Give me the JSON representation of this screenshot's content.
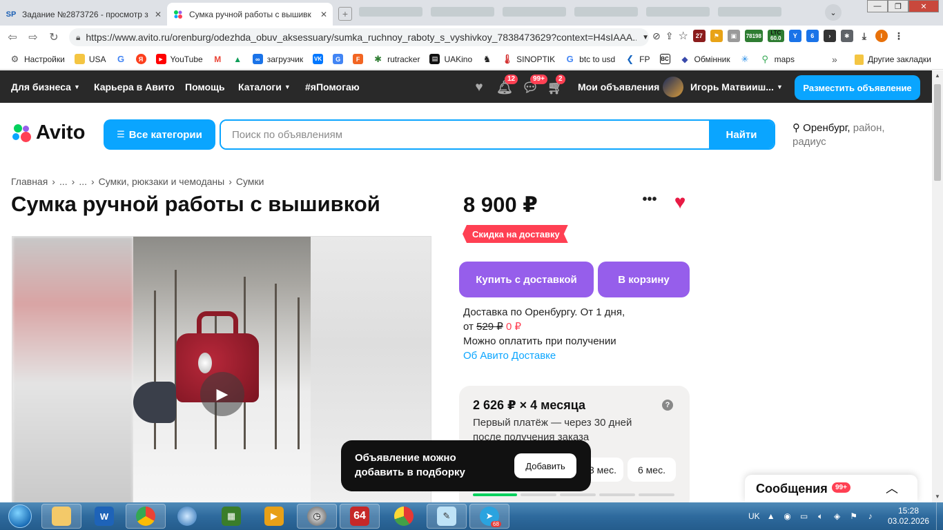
{
  "browser": {
    "tabs": [
      {
        "favicon": "SP",
        "title": "Задание №2873726 - просмотр з",
        "active": false
      },
      {
        "favicon": "avito-logo-icon",
        "title": "Сумка ручной работы с вышивк",
        "active": true
      }
    ],
    "url": "https://www.avito.ru/orenburg/odezhda_obuv_aksessuary/sumka_ruchnoy_raboty_s_vyshivkoy_7838473629?context=H4sIAAA...",
    "extensions": [
      {
        "label": "27"
      },
      {
        "label": "78198"
      },
      {
        "label": "LTC"
      },
      {
        "label": "60.0"
      },
      {
        "label": "6"
      }
    ],
    "bookmarks": [
      {
        "label": "Настройки",
        "icon": "gear-icon"
      },
      {
        "label": "USA",
        "icon": "folder-icon"
      },
      {
        "label": "",
        "icon": "google-icon"
      },
      {
        "label": "",
        "icon": "yandex-icon"
      },
      {
        "label": "YouTube",
        "icon": "youtube-icon"
      },
      {
        "label": "",
        "icon": "gmail-icon"
      },
      {
        "label": "",
        "icon": "drive-icon"
      },
      {
        "label": "загрузчик",
        "icon": "loader-icon"
      },
      {
        "label": "",
        "icon": "vk-icon"
      },
      {
        "label": "",
        "icon": "translate-icon"
      },
      {
        "label": "",
        "icon": "f-icon"
      },
      {
        "label": "rutracker",
        "icon": "rutracker-icon"
      },
      {
        "label": "UAKino",
        "icon": "uakino-icon"
      },
      {
        "label": "",
        "icon": "chess-icon"
      },
      {
        "label": "SINOPTIK",
        "icon": "thermometer-icon"
      },
      {
        "label": "btc to usd",
        "icon": "google-icon"
      },
      {
        "label": "FP",
        "icon": "fp-icon"
      },
      {
        "label": "",
        "icon": "bc-icon"
      },
      {
        "label": "Обмінник",
        "icon": "exchange-icon"
      },
      {
        "label": "",
        "icon": "snowflake-icon"
      },
      {
        "label": "maps",
        "icon": "maps-icon"
      }
    ],
    "bookmarks_more": "»",
    "other_bookmarks": "Другие закладки"
  },
  "avito": {
    "topnav": {
      "business": "Для бизнеса",
      "career": "Карьера в Авито",
      "help": "Помощь",
      "catalogs": "Каталоги",
      "charity": "#яПомогаю",
      "notifications_count": "12",
      "messages_count": "99+",
      "cart_count": "2",
      "my_ads": "Мои объявления",
      "user_name": "Игорь Матвииш...",
      "post_ad": "Разместить объявление"
    },
    "logo_text": "Avito",
    "all_categories": "Все категории",
    "search_placeholder": "Поиск по объявлениям",
    "search_button": "Найти",
    "location": {
      "city": "Оренбург,",
      "rest": " район, радиус"
    },
    "breadcrumb": [
      "Главная",
      "...",
      "...",
      "Сумки, рюкзаки и чемоданы",
      "Сумки"
    ],
    "breadcrumb_sep": "›",
    "title": "Сумка ручной работы с вышивкой",
    "price": "8 900 ₽",
    "more_menu": "•••",
    "promo": "Скидка на доставку",
    "buy_button": "Купить с доставкой",
    "cart_button": "В корзину",
    "delivery": {
      "line1": "Доставка по Оренбургу. От 1 дня,",
      "line2_prefix": "от ",
      "old_price": "529 ₽",
      "new_price": "0 ₽",
      "line3": "Можно оплатить при получении",
      "link": "Об Авито Доставке"
    },
    "installment": {
      "title": "2 626 ₽ × 4 месяца",
      "help": "?",
      "text": "Первый платёж — через 30 дней после получения заказа",
      "options": [
        "3 мес.",
        "6 мес."
      ]
    },
    "toast": {
      "text": "Объявление можно добавить в подборку",
      "button": "Добавить"
    },
    "messenger": {
      "label": "Сообщения",
      "count": "99+"
    }
  },
  "taskbar": {
    "language": "UK",
    "telegram_badge": "68",
    "app_64": "64",
    "time": "15:28",
    "date": "03.02.2026"
  },
  "colors": {
    "avito_blue": "#0aa5ff",
    "avito_purple": "#965eeb",
    "avito_red": "#ff4053",
    "avito_dark": "#292929"
  }
}
